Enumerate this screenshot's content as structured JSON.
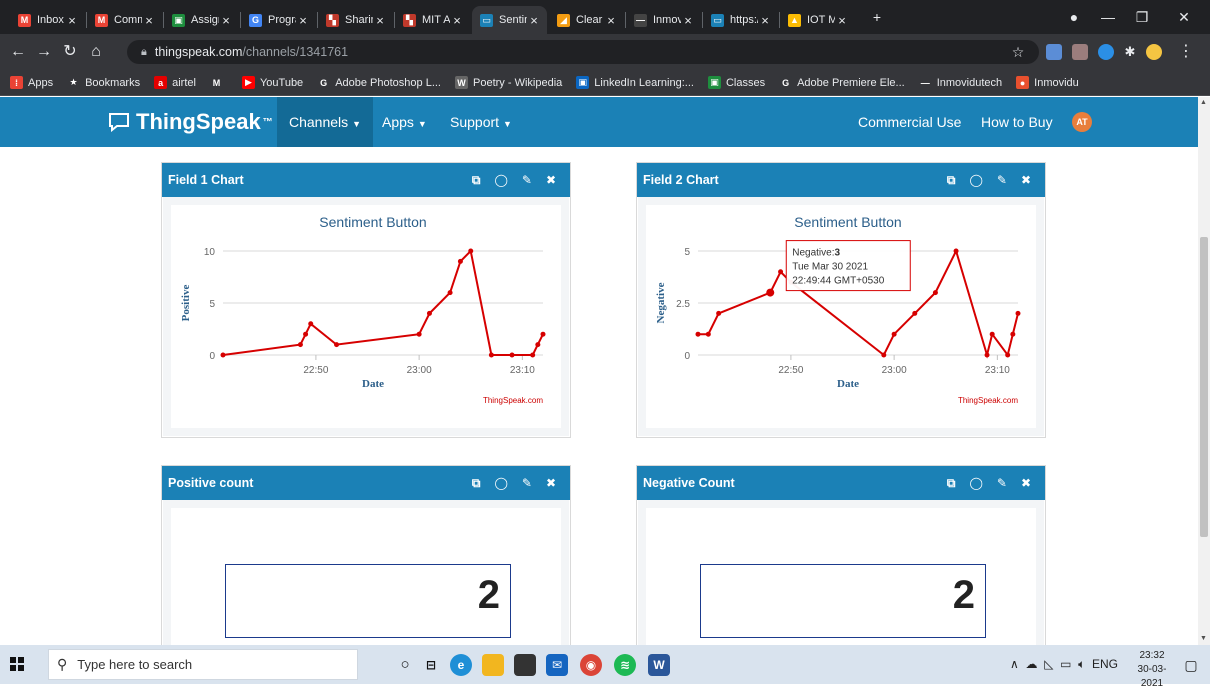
{
  "browser": {
    "tabs": [
      {
        "label": "Inbox (",
        "icon": "gmail-icon",
        "color": "#ea4335",
        "glyph": "M"
      },
      {
        "label": "Comm",
        "icon": "gmail-icon",
        "color": "#ea4335",
        "glyph": "M"
      },
      {
        "label": "Assign",
        "icon": "classroom-icon",
        "color": "#1e8e3e",
        "glyph": "▣"
      },
      {
        "label": "Progra",
        "icon": "google-icon",
        "color": "#4285f4",
        "glyph": "G"
      },
      {
        "label": "Sharin",
        "icon": "mit-icon",
        "color": "#c0392b",
        "glyph": "▚"
      },
      {
        "label": "MIT A",
        "icon": "mit-icon",
        "color": "#c0392b",
        "glyph": "▚"
      },
      {
        "label": "Sentim",
        "icon": "thingspeak-icon",
        "color": "#1b81b6",
        "glyph": "▭",
        "active": true
      },
      {
        "label": "Clear",
        "icon": "clear-icon",
        "color": "#f39c12",
        "glyph": "◢"
      },
      {
        "label": "Inmov",
        "icon": "inmovidu-icon",
        "color": "#444444",
        "glyph": "—"
      },
      {
        "label": "https:/",
        "icon": "thingspeak-icon",
        "color": "#1b81b6",
        "glyph": "▭"
      },
      {
        "label": "IOT M",
        "icon": "drive-icon",
        "color": "#fbbc04",
        "glyph": "▲"
      }
    ],
    "new_tab": "+",
    "url_host": "thingspeak.com",
    "url_path": "/channels/1341761",
    "bookmarks": [
      {
        "label": "Apps",
        "icon": "apps-grid-icon",
        "color": "#ea4335",
        "glyph": "⁞"
      },
      {
        "label": "Bookmarks",
        "icon": "star-icon",
        "color": "#35363a",
        "glyph": "★"
      },
      {
        "label": "airtel",
        "icon": "airtel-icon",
        "color": "#e40000",
        "glyph": "a"
      },
      {
        "label": "",
        "icon": "gmail-icon",
        "color": "#35363a",
        "glyph": "M"
      },
      {
        "label": "YouTube",
        "icon": "youtube-icon",
        "color": "#ff0000",
        "glyph": "▶"
      },
      {
        "label": "Adobe Photoshop L...",
        "icon": "google-icon",
        "color": "#35363a",
        "glyph": "G"
      },
      {
        "label": "Poetry - Wikipedia",
        "icon": "wikipedia-icon",
        "color": "#666666",
        "glyph": "W"
      },
      {
        "label": "LinkedIn Learning:...",
        "icon": "linkedin-icon",
        "color": "#0a66c2",
        "glyph": "▣"
      },
      {
        "label": "Classes",
        "icon": "classroom-icon",
        "color": "#1e8e3e",
        "glyph": "▣"
      },
      {
        "label": "Adobe Premiere Ele...",
        "icon": "google-icon",
        "color": "#35363a",
        "glyph": "G"
      },
      {
        "label": "Inmovidutech",
        "icon": "inmovidu-icon",
        "color": "#35363a",
        "glyph": "—"
      },
      {
        "label": "Inmovidu",
        "icon": "inmovidu-fire-icon",
        "color": "#e8502e",
        "glyph": "●"
      }
    ]
  },
  "thingspeak": {
    "brand": "ThingSpeak",
    "brand_tm": "™",
    "menu": [
      {
        "label": "Channels",
        "caret": true,
        "active": true
      },
      {
        "label": "Apps",
        "caret": true
      },
      {
        "label": "Support",
        "caret": true
      }
    ],
    "right_links": [
      "Commercial Use",
      "How to Buy"
    ],
    "avatar": "AT",
    "brand_color": "#1b81b6"
  },
  "widgets": {
    "field1": {
      "title": "Field 1 Chart"
    },
    "field2": {
      "title": "Field 2 Chart"
    },
    "positive": {
      "title": "Positive count",
      "value": "2"
    },
    "negative": {
      "title": "Negative Count",
      "value": "2"
    }
  },
  "chart_data": [
    {
      "type": "line",
      "title": "Sentiment Button",
      "xlabel": "Date",
      "ylabel": "Positive",
      "credit": "ThingSpeak.com",
      "xticks": [
        "22:50",
        "23:00",
        "23:10"
      ],
      "yticks": [
        "0",
        "5",
        "10"
      ],
      "xlim": [
        "22:41",
        "23:12"
      ],
      "ylim": [
        0,
        10
      ],
      "grid": true,
      "color": "#d60000",
      "x": [
        "22:41",
        "22:48.5",
        "22:49",
        "22:49.5",
        "22:52",
        "23:00",
        "23:01",
        "23:03",
        "23:04",
        "23:05",
        "23:07",
        "23:09",
        "23:11",
        "23:11.5",
        "23:12"
      ],
      "y": [
        0,
        1,
        2,
        3,
        1,
        2,
        4,
        6,
        9,
        10,
        0,
        0,
        0,
        1,
        2
      ]
    },
    {
      "type": "line",
      "title": "Sentiment Button",
      "xlabel": "Date",
      "ylabel": "Negative",
      "credit": "ThingSpeak.com",
      "xticks": [
        "22:50",
        "23:00",
        "23:10"
      ],
      "yticks": [
        "0",
        "2.5",
        "5"
      ],
      "xlim": [
        "22:41",
        "23:12"
      ],
      "ylim": [
        0,
        5
      ],
      "grid": true,
      "color": "#d60000",
      "x": [
        "22:41",
        "22:42",
        "22:43",
        "22:48",
        "22:49",
        "22:50",
        "22:59",
        "23:00",
        "23:02",
        "23:04",
        "23:06",
        "23:09",
        "23:09.5",
        "23:11",
        "23:11.5",
        "23:12"
      ],
      "y": [
        1,
        1,
        2,
        3,
        4,
        3.5,
        0,
        1,
        2,
        3,
        5,
        0,
        1,
        0,
        1,
        2
      ],
      "tooltip": {
        "series": "Negative",
        "value": "3",
        "date": "Tue Mar 30 2021",
        "time": "22:49:44 GMT+0530",
        "point_index": 3
      }
    }
  ],
  "taskbar": {
    "search_placeholder": "Type here to search",
    "tray_lang": "ENG",
    "time": "23:32",
    "date": "30-03-2021"
  }
}
